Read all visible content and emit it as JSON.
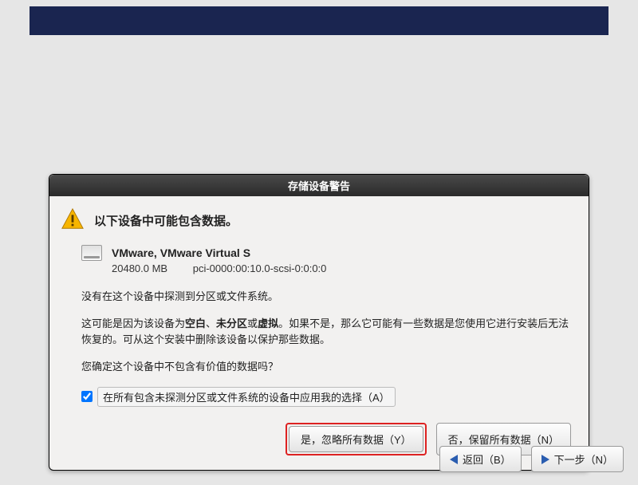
{
  "dialog": {
    "title": "存储设备警告",
    "heading": "以下设备中可能包含数据。",
    "device": {
      "name": "VMware, VMware Virtual S",
      "size": "20480.0 MB",
      "path": "pci-0000:00:10.0-scsi-0:0:0:0"
    },
    "para1": "没有在这个设备中探测到分区或文件系统。",
    "para2_pre": "这可能是因为该设备为",
    "para2_b1": "空白",
    "para2_sep1": "、",
    "para2_b2": "未分区",
    "para2_sep2": "或",
    "para2_b3": "虚拟",
    "para2_post": "。如果不是，那么它可能有一些数据是您使用它进行安装后无法恢复的。可从这个安装中删除该设备以保护那些数据。",
    "para3": "您确定这个设备中不包含有价值的数据吗？",
    "checkbox_label": "在所有包含未探测分区或文件系统的设备中应用我的选择（A）",
    "buttons": {
      "yes": "是，忽略所有数据（Y）",
      "no": "否，保留所有数据（N）"
    }
  },
  "nav": {
    "back": "返回（B）",
    "next": "下一步（N）"
  }
}
